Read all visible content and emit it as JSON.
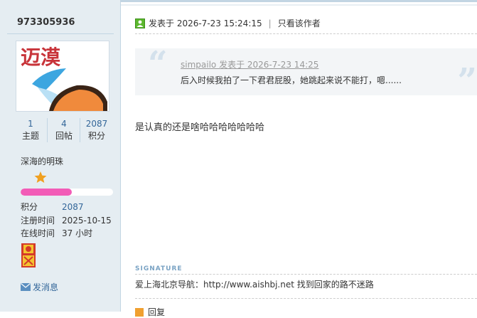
{
  "user": {
    "name": "973305936",
    "stats": [
      {
        "num": "1",
        "label": "主题"
      },
      {
        "num": "4",
        "label": "回帖"
      },
      {
        "num": "2087",
        "label": "积分"
      }
    ],
    "rank": "深海的明珠",
    "level_progress": 0.55,
    "profile": [
      {
        "key": "积分",
        "value": "2087"
      },
      {
        "key": "注册时间",
        "value": "2025-10-15"
      },
      {
        "key": "在线时间",
        "value": "37 小时"
      }
    ],
    "pm_label": "发消息"
  },
  "post": {
    "posted_at": "发表于 2026-7-23 15:24:15",
    "only_author": "只看该作者",
    "quote_head": "simpailo 发表于 2026-7-23 14:25",
    "quote_text": "后入时候我拍了一下君君屁股，她跳起来说不能打，嗯......",
    "reply_text": "是认真的还是啥哈哈哈哈哈哈哈",
    "signature_tag": "SIGNATURE",
    "signature": "爱上海北京导航：http://www.aishbj.net 找到回家的路不迷路",
    "reply_action": "回复"
  },
  "colors": {
    "sidebar_bg": "#e5edf2",
    "link": "#336699",
    "progress": "#f25cb7"
  }
}
